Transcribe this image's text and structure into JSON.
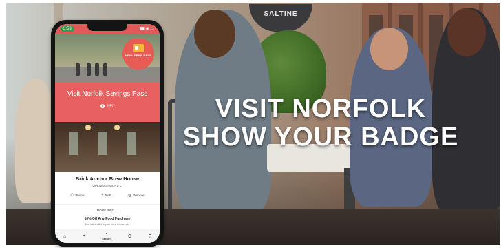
{
  "headline": {
    "line1": "VISIT NORFOLK",
    "line2": "SHOW YOUR BADGE"
  },
  "background": {
    "sign_text": "SALTINE"
  },
  "phone": {
    "status_time": "3:53",
    "status_icons": "▮▮ ◉ ▭",
    "hero_badge_text": "NEW: FREE PASS",
    "pass_title": "Visit Norfolk Savings Pass",
    "info_label": "INFO",
    "venue": {
      "name": "Brick Anchor Brew House",
      "hours_label": "OPENING HOURS ⌄",
      "actions": [
        {
          "icon": "phone-icon",
          "glyph": "✆",
          "label": "Phone"
        },
        {
          "icon": "map-pin-icon",
          "glyph": "⌖",
          "label": "Map"
        },
        {
          "icon": "globe-icon",
          "glyph": "◍",
          "label": "Website"
        }
      ],
      "more_info": "MORE INFO ⌄"
    },
    "offer": {
      "title": "10% Off Any Food Purchase",
      "note": "Not valid with happy hour discounts."
    },
    "tabbar": {
      "home_glyph": "⌂",
      "map_glyph": "⌖",
      "menu_glyph": "⌃",
      "menu_label": "MENU",
      "settings_glyph": "⚙",
      "help_glyph": "?"
    }
  },
  "colors": {
    "brand_red": "#e86060",
    "status_green": "#2f9e4a"
  }
}
